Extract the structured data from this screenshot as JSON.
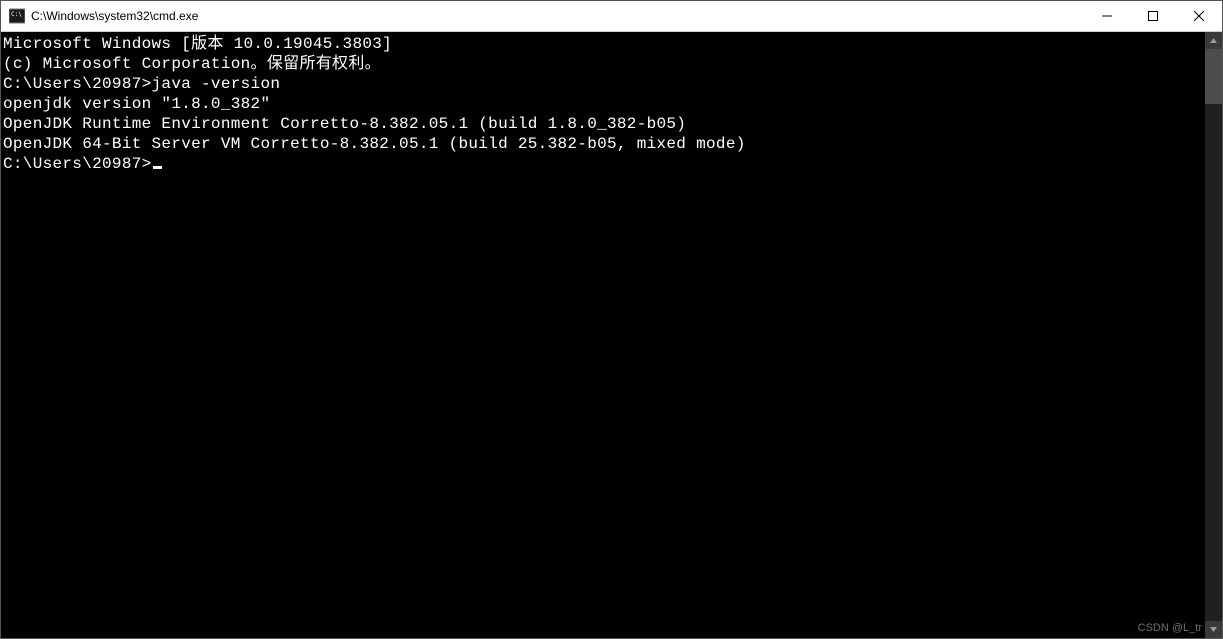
{
  "titlebar": {
    "title": "C:\\Windows\\system32\\cmd.exe"
  },
  "terminal": {
    "lines": [
      "Microsoft Windows [版本 10.0.19045.3803]",
      "(c) Microsoft Corporation。保留所有权利。",
      "",
      "C:\\Users\\20987>java -version",
      "openjdk version \"1.8.0_382\"",
      "OpenJDK Runtime Environment Corretto-8.382.05.1 (build 1.8.0_382-b05)",
      "OpenJDK 64-Bit Server VM Corretto-8.382.05.1 (build 25.382-b05, mixed mode)",
      "",
      "C:\\Users\\20987>"
    ],
    "prompt_line_index": 8
  },
  "watermark": "CSDN @L_tr"
}
